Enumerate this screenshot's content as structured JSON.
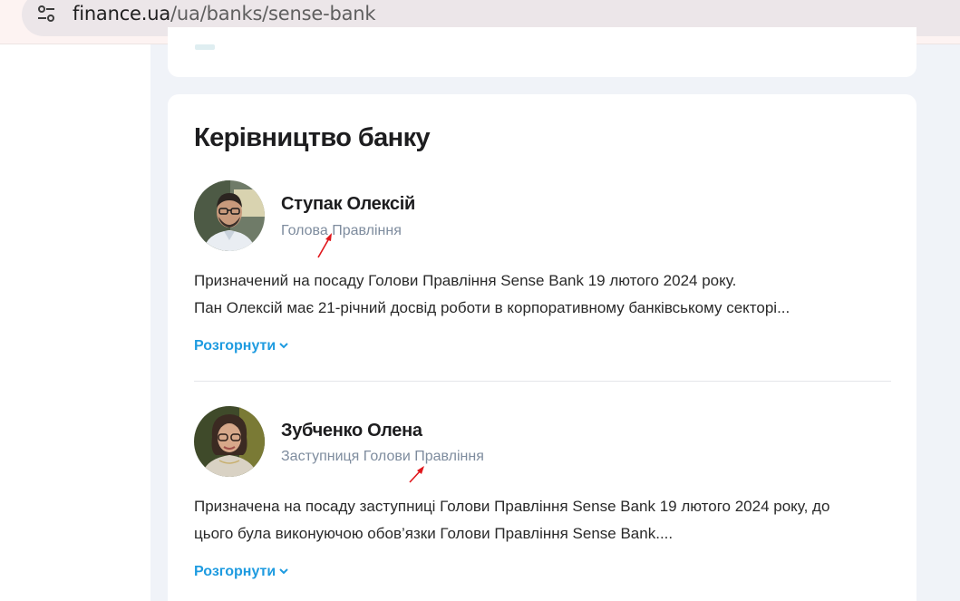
{
  "browser": {
    "url_host": "finance.ua",
    "url_path": "/ua/banks/sense-bank"
  },
  "section": {
    "title": "Керівництво банку",
    "expand_label": "Розгорнути"
  },
  "people": [
    {
      "name": "Ступак Олексій",
      "role": "Голова Правління",
      "bio_line1": "Призначений на посаду Голови Правління Sense Bank 19 лютого 2024 року.",
      "bio_line2": "Пан Олексій має 21-річний досвід роботи в корпоративному банківському секторі..."
    },
    {
      "name": "Зубченко Олена",
      "role": "Заступниця Голови Правління",
      "bio_line1": "Призначена на посаду заступниці Голови Правління Sense Bank 19 лютого 2024 року, до",
      "bio_line2": "цього була виконуючою обов’язки Голови Правління Sense Bank...."
    }
  ],
  "colors": {
    "accent_link": "#1e9be0",
    "role_text": "#7e8c9e",
    "annotation_arrow": "#e0161b"
  }
}
